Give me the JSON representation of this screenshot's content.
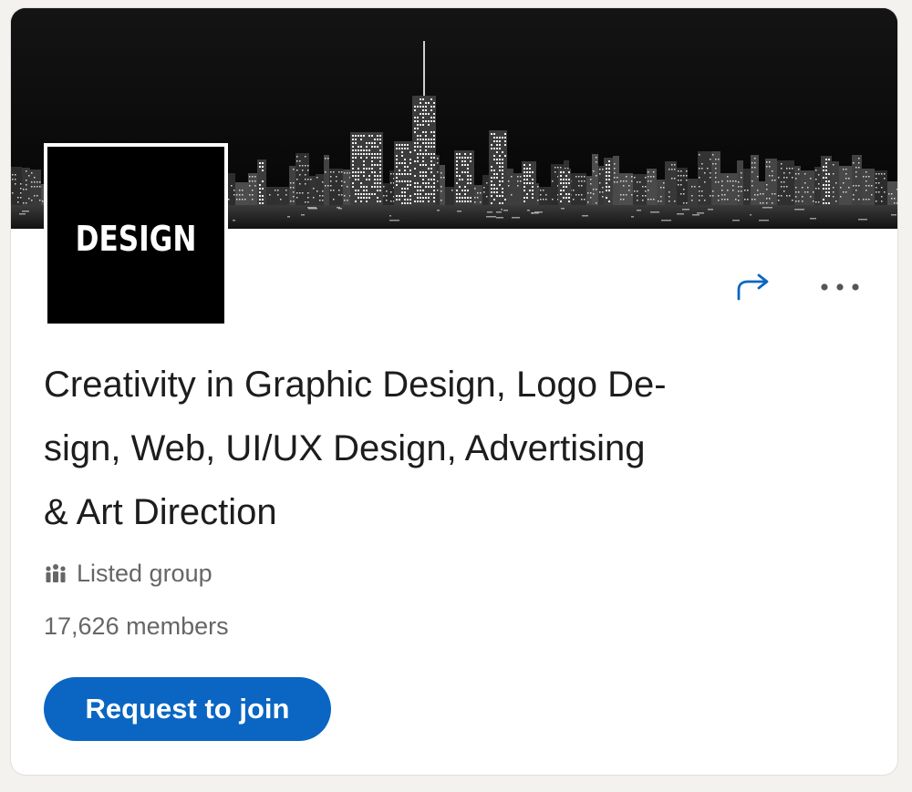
{
  "group": {
    "logo_text": "DESIGN",
    "title": "Creativity in Graphic Design, Logo De-sign, Web, UI/UX Design, Advertising & Art Direction",
    "title_lines": [
      "Creativity in Graphic Design, Logo De-",
      "sign, Web, UI/UX Design, Advertising",
      "& Art Direction"
    ],
    "visibility": "Listed group",
    "members": "17,626 members"
  },
  "actions": {
    "join_label": "Request to join",
    "share_icon": "share-icon",
    "more_icon": "more-options-icon"
  },
  "colors": {
    "accent": "#0a66c2",
    "background": "#f3f2ef",
    "card": "#ffffff",
    "text_primary": "#1d1d1d",
    "text_secondary": "#666666"
  }
}
